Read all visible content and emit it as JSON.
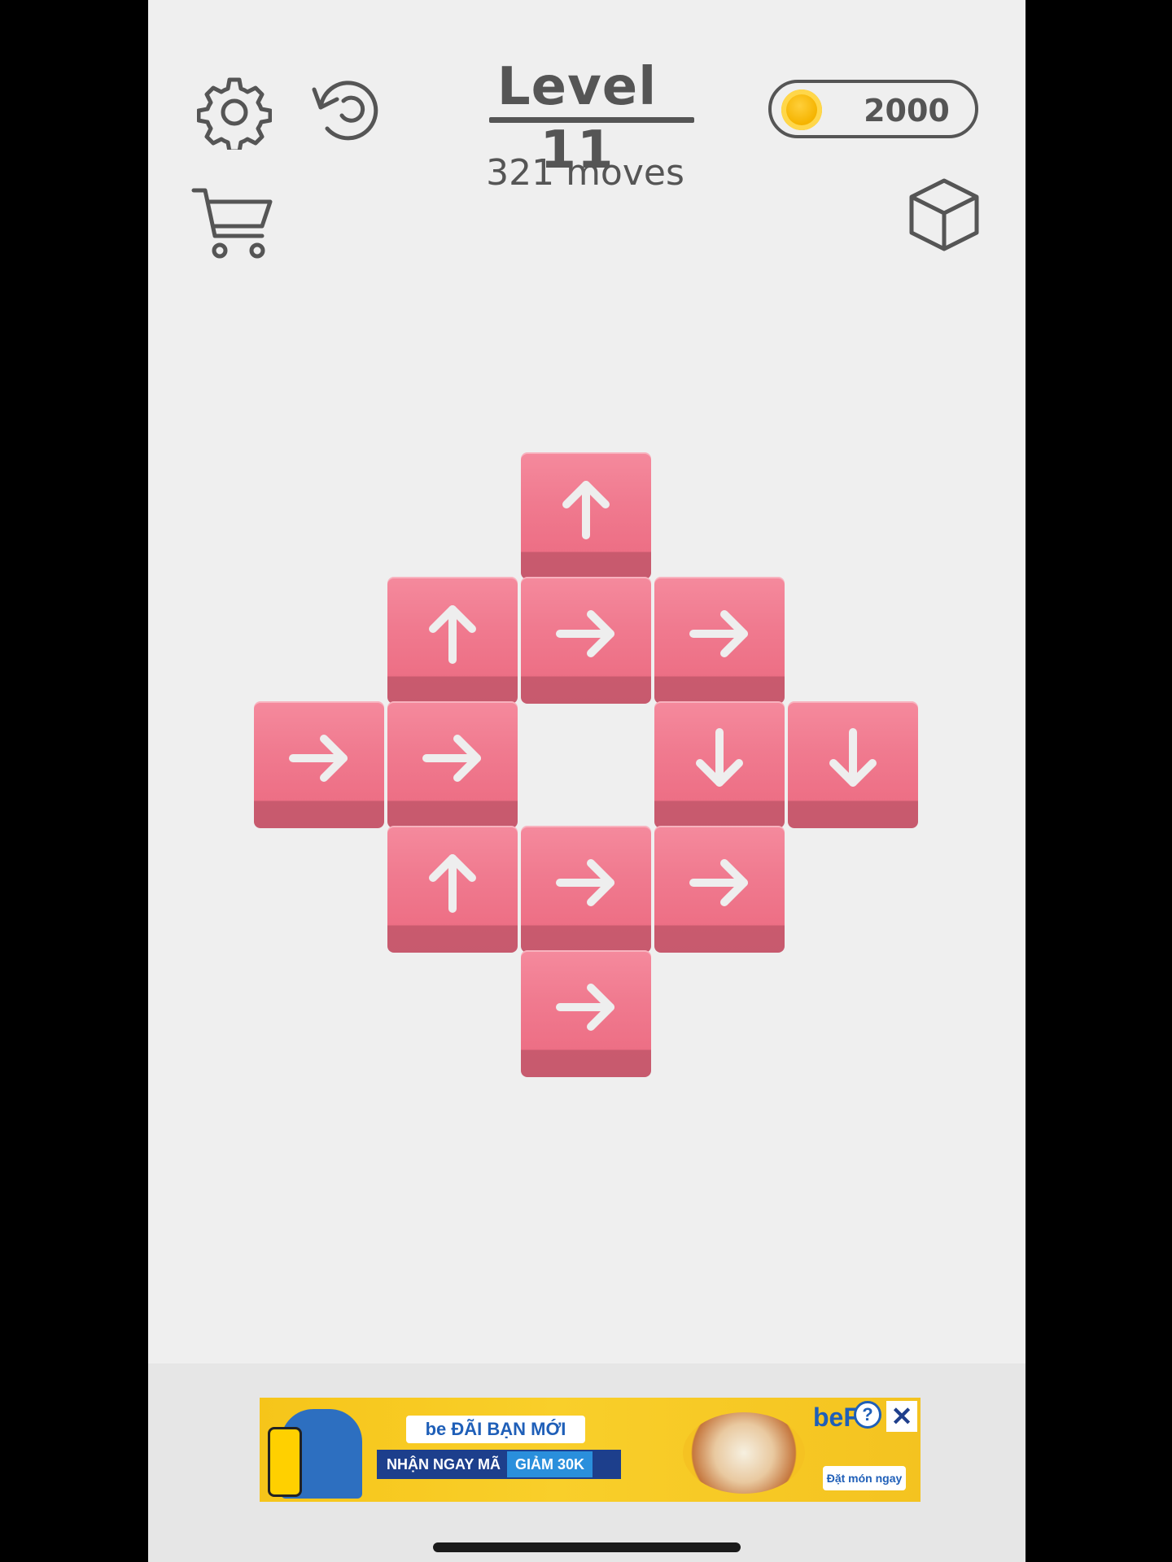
{
  "header": {
    "level_title": "Level 11",
    "moves_text": "321 moves",
    "coins": "2000"
  },
  "icons": {
    "settings": "gear-icon",
    "restart": "restart-icon",
    "shop": "cart-icon",
    "skins": "cube-icon",
    "coin": "coin-icon"
  },
  "board": {
    "tile_color": "#f07a8f",
    "arrow_color": "#eeeeee",
    "tiles": [
      {
        "row": 0,
        "col": 2,
        "dir": "up"
      },
      {
        "row": 1,
        "col": 1,
        "dir": "up"
      },
      {
        "row": 1,
        "col": 2,
        "dir": "right"
      },
      {
        "row": 1,
        "col": 3,
        "dir": "right"
      },
      {
        "row": 2,
        "col": 0,
        "dir": "right"
      },
      {
        "row": 2,
        "col": 1,
        "dir": "right"
      },
      {
        "row": 2,
        "col": 3,
        "dir": "down"
      },
      {
        "row": 2,
        "col": 4,
        "dir": "down"
      },
      {
        "row": 3,
        "col": 1,
        "dir": "up"
      },
      {
        "row": 3,
        "col": 2,
        "dir": "right"
      },
      {
        "row": 3,
        "col": 3,
        "dir": "right"
      },
      {
        "row": 4,
        "col": 2,
        "dir": "right"
      }
    ]
  },
  "ad": {
    "headline": "be ĐÃI BẠN MỚI",
    "sub_left": "NHẬN NGAY MÃ",
    "sub_right": "GIẢM 30K",
    "brand": "beF",
    "cta": "Đặt món ngay",
    "info": "?",
    "close": "✕"
  }
}
